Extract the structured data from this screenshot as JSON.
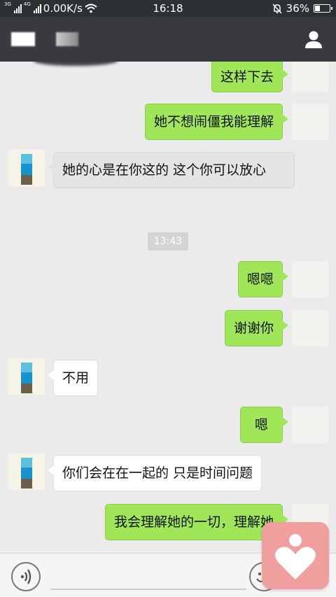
{
  "status_bar": {
    "net_tag_1": "3G",
    "net_tag_2": "4G",
    "speed": "0.00K/s",
    "time": "16:18",
    "battery": "36%",
    "battery_level": 0.36
  },
  "chat": {
    "timestamp": "13:43",
    "messages": [
      {
        "sender": "me",
        "text": "这样下去"
      },
      {
        "sender": "me",
        "text": "她不想闹僵我能理解"
      },
      {
        "sender": "them",
        "text": "她的心是在你这的 这个你可以放心"
      },
      {
        "sender": "me",
        "text": "嗯嗯"
      },
      {
        "sender": "me",
        "text": "谢谢你"
      },
      {
        "sender": "them",
        "text": "不用"
      },
      {
        "sender": "me",
        "text": "嗯"
      },
      {
        "sender": "them",
        "text": "你们会在在一起的 只是时间问题"
      },
      {
        "sender": "me",
        "text": "我会理解她的一切，理解她"
      }
    ]
  },
  "icons": {
    "title_right": "person-icon",
    "bottom_left": "voice-icon",
    "bottom_right": "emoji-icon",
    "overlay": "heart-icon"
  },
  "colors": {
    "my_bubble": "#9fe658",
    "their_bubble": "#ffffff",
    "title_bar": "#393a3f",
    "chat_bg": "#ebebeb",
    "heart_badge": "#f19e9e"
  }
}
